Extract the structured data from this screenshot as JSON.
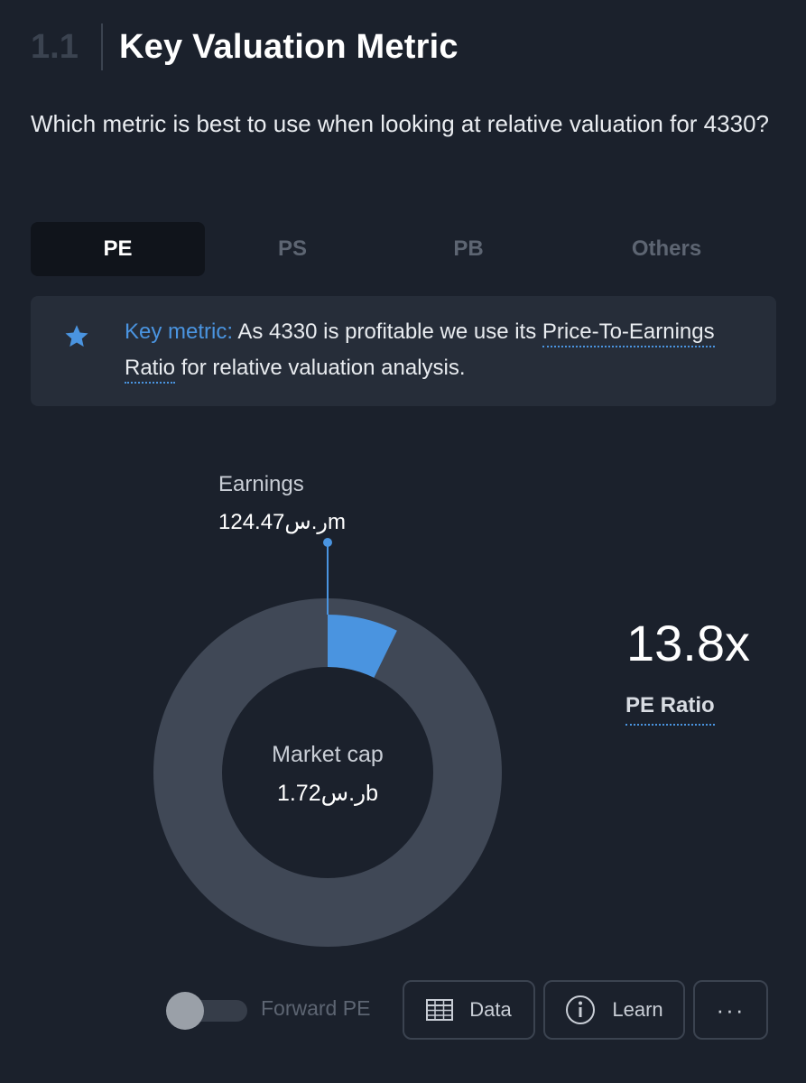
{
  "header": {
    "section_number": "1.1",
    "title": "Key Valuation Metric"
  },
  "question": "Which metric is best to use when looking at relative valuation for 4330?",
  "tabs": [
    {
      "label": "PE",
      "active": true
    },
    {
      "label": "PS",
      "active": false
    },
    {
      "label": "PB",
      "active": false
    },
    {
      "label": "Others",
      "active": false
    }
  ],
  "info": {
    "icon": "star-icon",
    "key_label": "Key metric:",
    "text_before_link": " As 4330 is profitable we use its ",
    "link_text": "Price-To-Earnings Ratio",
    "text_after_link": " for relative valuation analysis."
  },
  "chart_data": {
    "type": "pie",
    "donut": true,
    "slices": [
      {
        "label": "Earnings",
        "value_text": "124.47ر.سm",
        "value": 124.47,
        "color": "#4a94e0"
      },
      {
        "label": "Market cap",
        "value_text": "1.72ر.سb",
        "value": 1720,
        "color": "#404856"
      }
    ],
    "center_label": "Market cap",
    "center_value": "1.72ر.سb",
    "callout_label": "Earnings",
    "callout_value": "124.47ر.سm"
  },
  "metric": {
    "value": "13.8x",
    "label": "PE Ratio"
  },
  "toolbar": {
    "toggle_label": "Forward PE",
    "toggle_on": false,
    "data_label": "Data",
    "learn_label": "Learn",
    "more_label": "···"
  },
  "colors": {
    "background": "#1b212c",
    "card": "#262d39",
    "accent": "#4a94e0",
    "muted": "#5d6572"
  }
}
